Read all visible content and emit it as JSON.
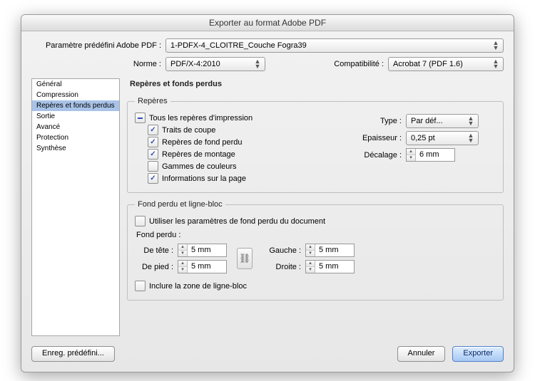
{
  "title": "Exporter au format Adobe PDF",
  "preset": {
    "label": "Paramètre prédéfini Adobe PDF :",
    "value": "1-PDFX-4_CLOITRE_Couche Fogra39"
  },
  "norme": {
    "label": "Norme :",
    "value": "PDF/X-4:2010"
  },
  "compat": {
    "label": "Compatibilité :",
    "value": "Acrobat 7 (PDF 1.6)"
  },
  "sidebar": [
    {
      "label": "Général"
    },
    {
      "label": "Compression"
    },
    {
      "label": "Repères et fonds perdus",
      "selected": true
    },
    {
      "label": "Sortie"
    },
    {
      "label": "Avancé"
    },
    {
      "label": "Protection"
    },
    {
      "label": "Synthèse"
    }
  ],
  "section_title": "Repères et fonds perdus",
  "marks": {
    "legend": "Repères",
    "all": "Tous les repères d'impression",
    "children": [
      {
        "label": "Traits de coupe",
        "checked": true
      },
      {
        "label": "Repères de fond perdu",
        "checked": true
      },
      {
        "label": "Repères de montage",
        "checked": true
      },
      {
        "label": "Gammes de couleurs",
        "checked": false
      },
      {
        "label": "Informations sur la page",
        "checked": true
      }
    ],
    "type_label": "Type :",
    "type_value": "Par déf...",
    "weight_label": "Epaisseur :",
    "weight_value": "0,25 pt",
    "offset_label": "Décalage :",
    "offset_value": "6 mm"
  },
  "bleed": {
    "legend": "Fond perdu et ligne-bloc",
    "use_doc": "Utiliser les paramètres de fond perdu du document",
    "heading": "Fond perdu :",
    "top_l": "De tête :",
    "top_v": "5 mm",
    "bottom_l": "De pied :",
    "bottom_v": "5 mm",
    "left_l": "Gauche :",
    "left_v": "5 mm",
    "right_l": "Droite :",
    "right_v": "5 mm",
    "slug": "Inclure la zone de ligne-bloc"
  },
  "buttons": {
    "save": "Enreg. prédéfini...",
    "cancel": "Annuler",
    "export": "Exporter"
  }
}
